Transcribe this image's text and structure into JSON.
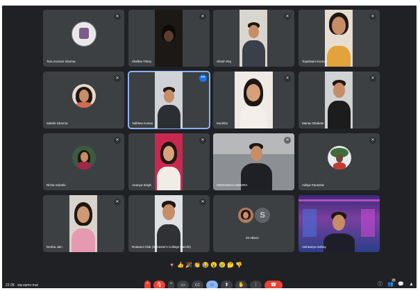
{
  "participants": [
    {
      "name": "Tanu Kumari sharma"
    },
    {
      "name": "Shellee Tirkey"
    },
    {
      "name": "Shrish Raj"
    },
    {
      "name": "Tejashwini Kumari"
    },
    {
      "name": "Sakshi Sharma"
    },
    {
      "name": "Vaibhav Kumar"
    },
    {
      "name": "Mudrika"
    },
    {
      "name": "Manav Dhakate"
    },
    {
      "name": "Richa Sulanki"
    },
    {
      "name": "Ananya Singh"
    },
    {
      "name": "HEMANSHU MISHRA"
    },
    {
      "name": "Aditya Parashar"
    },
    {
      "name": "Deeba Jain"
    },
    {
      "name": "Rotaract Club (St Xavier's College Ranchi)"
    },
    {
      "name": "20 others",
      "initial": "S"
    },
    {
      "name": "Aishwarya Sahay"
    }
  ],
  "reactions": [
    "♥",
    "👍",
    "🎉",
    "👏",
    "😂",
    "😮",
    "😢",
    "🤔",
    "👎"
  ],
  "meeting": {
    "time": "22:28",
    "code": "ziq-vqmv-mai"
  },
  "controls": {
    "more_options": "⌃",
    "mic": "🎙",
    "camera_caret": "⌃",
    "camera": "▭",
    "captions": "CC",
    "reactions": "☺",
    "present": "⬆",
    "raise_hand": "✋",
    "more": "⋮",
    "leave": "☎"
  },
  "right": {
    "info": "ⓘ",
    "people": "👥",
    "people_count": "26",
    "chat": "💬",
    "activities": "▲"
  },
  "colors": {
    "background": "#202124",
    "tile": "#3c4043",
    "accent": "#8ab4f8",
    "danger": "#ea4335"
  }
}
